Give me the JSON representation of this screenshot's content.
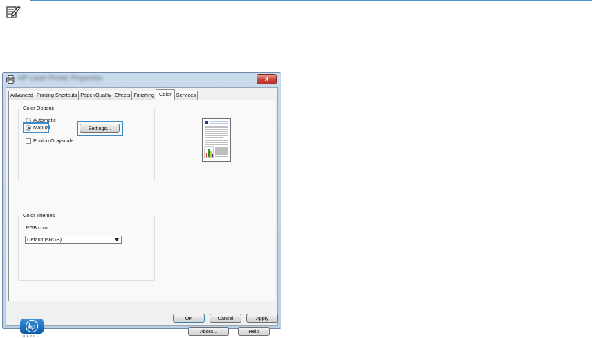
{
  "note": {
    "icon": "note-pencil-icon"
  },
  "dialog": {
    "title": "HP Laser Printer Properties",
    "window_icon": "printer-icon",
    "close_label": "x",
    "tabs": [
      "Advanced",
      "Printing Shortcuts",
      "Paper/Quality",
      "Effects",
      "Finishing",
      "Color",
      "Services"
    ],
    "active_tab": "Color",
    "color_options": {
      "legend": "Color Options",
      "automatic_label": "Automatic",
      "manual_label": "Manual",
      "selected": "Manual",
      "settings_button": "Settings...",
      "grayscale_label": "Print in Grayscale",
      "grayscale_checked": false
    },
    "color_themes": {
      "legend": "Color Themes",
      "rgb_label": "RGB color:",
      "rgb_value": "Default (sRGB)"
    },
    "buttons": {
      "about": "About...",
      "help": "Help",
      "ok": "OK",
      "cancel": "Cancel",
      "apply": "Apply"
    },
    "logo": {
      "text": "invent",
      "icon": "hp-logo-icon"
    }
  },
  "colors": {
    "highlight": "#3a8bc8",
    "rule": "#4a8fc8",
    "dialog_frame": "#b9cfe6"
  }
}
